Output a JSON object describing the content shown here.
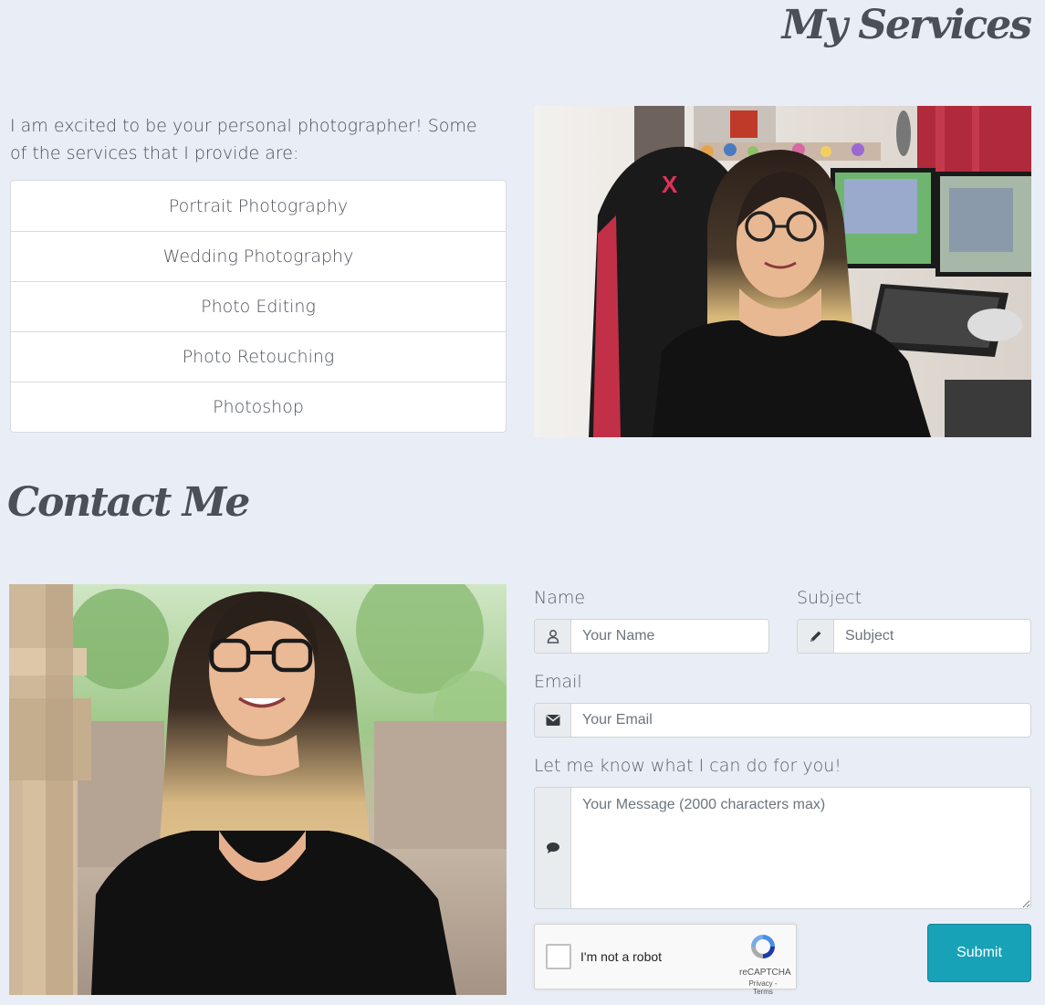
{
  "services": {
    "title": "My Services",
    "intro": "I am excited to be your personal photographer! Some of the services that I provide are:",
    "items": [
      "Portrait Photography",
      "Wedding Photography",
      "Photo Editing",
      "Photo Retouching",
      "Photoshop"
    ]
  },
  "contact": {
    "title": "Contact Me",
    "name_label": "Name",
    "name_placeholder": "Your Name",
    "subject_label": "Subject",
    "subject_placeholder": "Subject",
    "email_label": "Email",
    "email_placeholder": "Your Email",
    "message_label": "Let me know what I can do for you!",
    "message_placeholder": "Your Message (2000 characters max)",
    "recaptcha_label": "I'm not a robot",
    "recaptcha_brand": "reCAPTCHA",
    "recaptcha_links": "Privacy - Terms",
    "submit_label": "Submit"
  },
  "icons": {
    "name": "user-icon",
    "subject": "pencil-icon",
    "email": "envelope-icon",
    "message": "comment-icon"
  },
  "colors": {
    "background": "#e9edf5",
    "submit": "#17a2b8",
    "title": "#4a4f58"
  }
}
